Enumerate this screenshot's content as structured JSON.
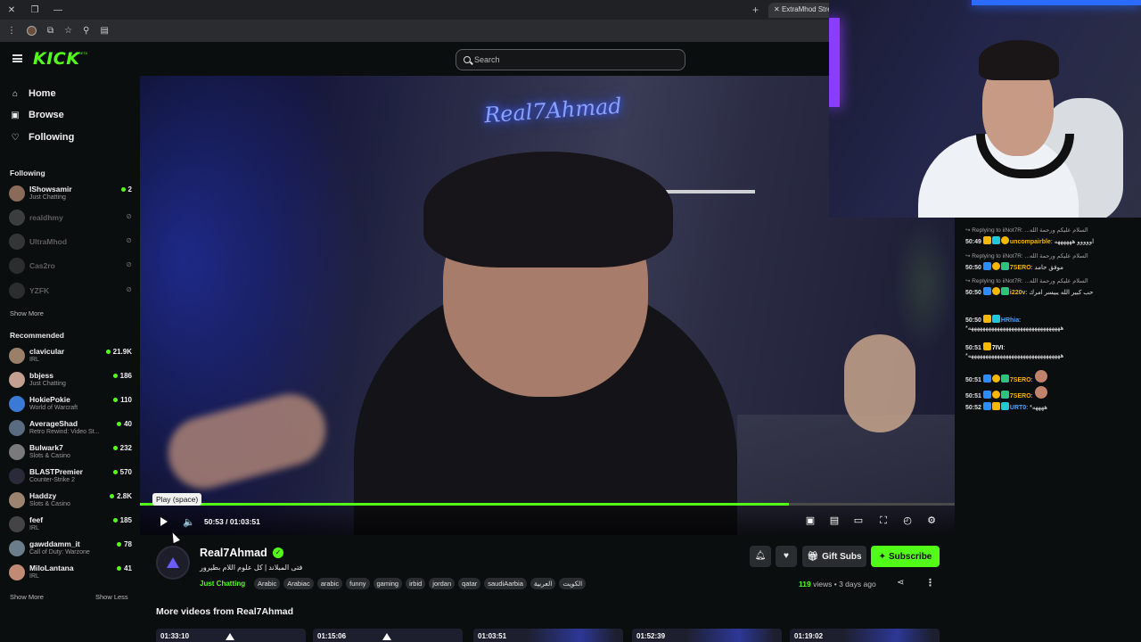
{
  "browser": {
    "tab_title": "ExtraMhod Stream",
    "new_tab_icon": "plus-icon"
  },
  "header": {
    "logo_text": "KICK",
    "logo_badge": "BETA",
    "search_placeholder": "Search"
  },
  "sidebar": {
    "nav": [
      {
        "label": "Home",
        "icon": "home-icon"
      },
      {
        "label": "Browse",
        "icon": "browse-icon"
      },
      {
        "label": "Following",
        "icon": "heart-icon"
      }
    ],
    "following_title": "Following",
    "following": [
      {
        "name": "IShowsamir",
        "category": "Just Chatting",
        "viewers": "2",
        "live": true
      },
      {
        "name": "realdhmy",
        "category": "",
        "viewers": "",
        "live": false
      },
      {
        "name": "UltraMhod",
        "category": "",
        "viewers": "",
        "live": false
      },
      {
        "name": "Cas2ro",
        "category": "",
        "viewers": "",
        "live": false
      },
      {
        "name": "YZFK",
        "category": "",
        "viewers": "",
        "live": false
      }
    ],
    "show_more_1": "Show More",
    "recommended_title": "Recommended",
    "recommended": [
      {
        "name": "clavicular",
        "category": "IRL",
        "viewers": "21.9K"
      },
      {
        "name": "bbjess",
        "category": "Just Chatting",
        "viewers": "186"
      },
      {
        "name": "HokiePokie",
        "category": "World of Warcraft",
        "viewers": "110"
      },
      {
        "name": "AverageShad",
        "category": "Retro Rewind: Video St...",
        "viewers": "40"
      },
      {
        "name": "Bulwark7",
        "category": "Slots & Casino",
        "viewers": "232"
      },
      {
        "name": "BLASTPremier",
        "category": "Counter-Strike 2",
        "viewers": "570"
      },
      {
        "name": "Haddzy",
        "category": "Slots & Casino",
        "viewers": "2.8K"
      },
      {
        "name": "feef",
        "category": "IRL",
        "viewers": "185"
      },
      {
        "name": "gawddamm_it",
        "category": "Call of Duty: Warzone",
        "viewers": "78"
      },
      {
        "name": "MiloLantana",
        "category": "IRL",
        "viewers": "41"
      }
    ],
    "show_more_2": "Show More",
    "show_less": "Show Less"
  },
  "player": {
    "neon_sign": "Real7Ahmad",
    "tooltip": "Play (space)",
    "time": "50:53 / 01:03:51",
    "progress": 0.797
  },
  "chat": {
    "messages": [
      {
        "reply": "Replying to iiNot7R: ...السلام عليكم ورحمة الله",
        "ts": "50:49",
        "user": "uncompairble",
        "user_color": "#f5b700",
        "text": "اووووو ههههههه"
      },
      {
        "reply": "Replying to iiNot7R: ...السلام عليكم ورحمة الله",
        "ts": "50:50",
        "user": "7SERO",
        "user_color": "#f5b700",
        "text": "موفق حامد"
      },
      {
        "reply": "Replying to iiNot7R: ...السلام عليكم ورحمة الله",
        "ts": "50:50",
        "user": "i220v",
        "user_color": "#f5b700",
        "text": "حب كبير الله يبيسر امرك"
      },
      {
        "reply": "",
        "ts": "50:50",
        "user": "HRhia",
        "user_color": "#4aa3ff",
        "text": "*ههههههههههههههههههههههههههههههههه"
      },
      {
        "reply": "",
        "ts": "50:51",
        "user": "7IVI",
        "user_color": "#ffffff",
        "text": "*ههههههههههههههههههههههههههههههههه"
      },
      {
        "reply": "",
        "ts": "50:51",
        "user": "7SERO",
        "user_color": "#f5b700",
        "text": ""
      },
      {
        "reply": "",
        "ts": "50:51",
        "user": "7SERO",
        "user_color": "#f5b700",
        "text": ""
      },
      {
        "reply": "",
        "ts": "50:52",
        "user": "URT0",
        "user_color": "#4aa3ff",
        "text": "*ههههه"
      }
    ]
  },
  "channel": {
    "name": "Real7Ahmad",
    "title": "فتى المبلاند | كل علوم اللام بطيرور",
    "category": "Just Chatting",
    "tags": [
      "Arabic",
      "Arabiac",
      "arabic",
      "funny",
      "gaming",
      "irbid",
      "jordan",
      "qatar",
      "saudiAarbia",
      "العربية",
      "الكويت"
    ],
    "gift_label": "Gift Subs",
    "subscribe_label": "Subscribe",
    "views_count": "119",
    "views_label": "views",
    "separator": "•",
    "uploaded": "3 days ago"
  },
  "more_videos": {
    "title": "More videos from Real7Ahmad",
    "durations": [
      "01:33:10",
      "01:15:06",
      "01:03:51",
      "01:52:39",
      "01:19:02"
    ]
  }
}
